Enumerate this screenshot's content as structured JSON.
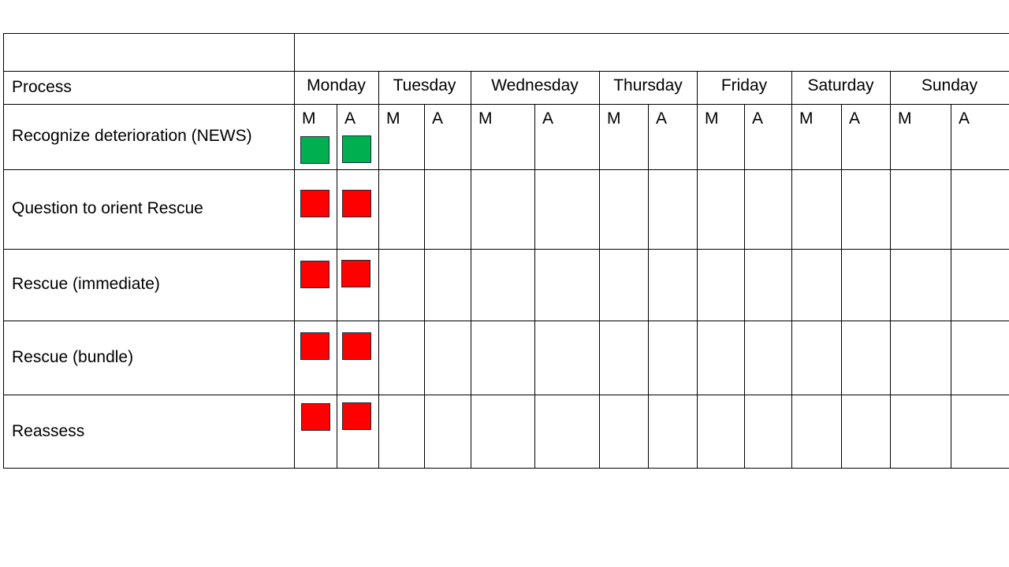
{
  "table": {
    "header_label": "Process",
    "days": [
      {
        "name": "Monday",
        "slots": [
          "M",
          "A"
        ]
      },
      {
        "name": "Tuesday",
        "slots": [
          "M",
          "A"
        ]
      },
      {
        "name": "Wednesday",
        "slots": [
          "M",
          "A"
        ]
      },
      {
        "name": "Thursday",
        "slots": [
          "M",
          "A"
        ]
      },
      {
        "name": "Friday",
        "slots": [
          "M",
          "A"
        ]
      },
      {
        "name": "Saturday",
        "slots": [
          "M",
          "A"
        ]
      },
      {
        "name": "Sunday",
        "slots": [
          "M",
          "A"
        ]
      }
    ],
    "rows": [
      {
        "process": "Recognize deterioration (NEWS)",
        "status": {
          "Monday M": "green",
          "Monday A": "green"
        }
      },
      {
        "process": "Question to orient Rescue",
        "status": {
          "Monday M": "red",
          "Monday A": "red"
        }
      },
      {
        "process": "Rescue (immediate)",
        "status": {
          "Monday M": "red",
          "Monday A": "red"
        }
      },
      {
        "process": "Rescue (bundle)",
        "status": {
          "Monday M": "red",
          "Monday A": "red"
        }
      },
      {
        "process": "Reassess",
        "status": {
          "Monday M": "red",
          "Monday A": "red"
        }
      }
    ]
  },
  "colors": {
    "green": "#00b050",
    "red": "#ff0000",
    "border": "#000000"
  }
}
